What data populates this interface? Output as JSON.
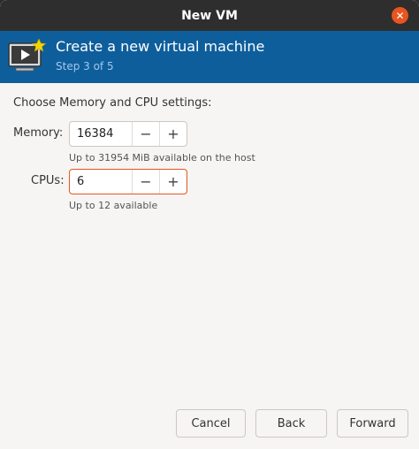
{
  "window": {
    "title": "New VM"
  },
  "header": {
    "title": "Create a new virtual machine",
    "subtitle": "Step 3 of 5"
  },
  "content": {
    "section_label": "Choose Memory and CPU settings:",
    "memory": {
      "label": "Memory:",
      "value": "16384",
      "decrement": "−",
      "increment": "+",
      "hint": "Up to 31954 MiB available on the host"
    },
    "cpus": {
      "label": "CPUs:",
      "value": "6",
      "decrement": "−",
      "increment": "+",
      "hint": "Up to 12 available"
    }
  },
  "footer": {
    "cancel": "Cancel",
    "back": "Back",
    "forward": "Forward"
  },
  "colors": {
    "accent": "#e95420",
    "header_bg": "#0f5e9c",
    "titlebar_bg": "#2e2e2e"
  }
}
